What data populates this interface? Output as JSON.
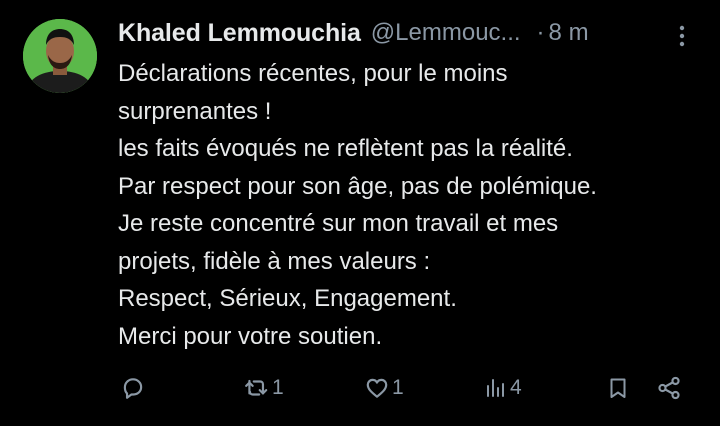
{
  "tweet": {
    "author": {
      "display_name": "Khaled Lemmouchia",
      "handle": "@Lemmouc...",
      "avatar_icon": "profile-photo"
    },
    "separator": "·",
    "time": "8 m",
    "lines": [
      "Déclarations récentes, pour le moins",
      "surprenantes !",
      "les faits évoqués ne reflètent pas la réalité.",
      "Par respect pour son âge, pas de polémique.",
      "Je reste concentré sur mon travail et mes",
      "projets, fidèle à mes valeurs :",
      "Respect, Sérieux, Engagement.",
      "Merci pour votre soutien."
    ],
    "actions": {
      "reply": {
        "icon": "reply-icon",
        "count": ""
      },
      "retweet": {
        "icon": "retweet-icon",
        "count": "1"
      },
      "like": {
        "icon": "heart-icon",
        "count": "1"
      },
      "views": {
        "icon": "views-icon",
        "count": "4"
      },
      "bookmark": {
        "icon": "bookmark-icon"
      },
      "share": {
        "icon": "share-icon"
      }
    }
  },
  "colors": {
    "background": "#000000",
    "primary_text": "#e7e9ea",
    "secondary_text": "#8b98a5",
    "avatar_bg": "#5bb84a"
  }
}
